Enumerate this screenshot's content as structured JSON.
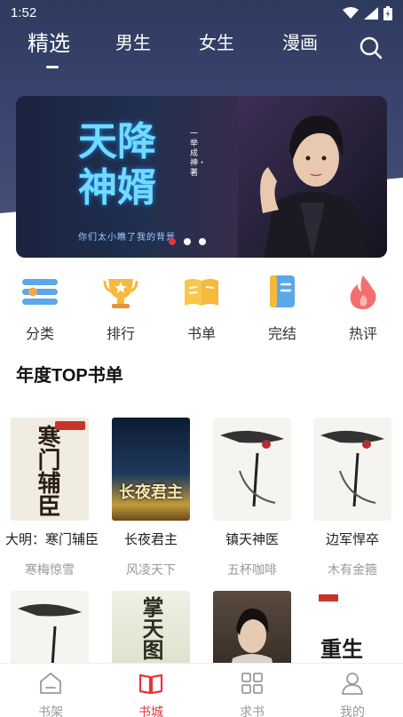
{
  "status": {
    "time": "1:52"
  },
  "tabs": [
    {
      "label": "精选",
      "active": true
    },
    {
      "label": "男生"
    },
    {
      "label": "女生"
    },
    {
      "label": "漫画"
    }
  ],
  "banner": {
    "title": "天降神婿",
    "author": "一举成神・著",
    "tagline": "你们太小瞧了我的背景",
    "slides": 3,
    "active_slide": 1
  },
  "quick_nav": [
    {
      "label": "分类",
      "icon": "category-icon"
    },
    {
      "label": "排行",
      "icon": "trophy-icon"
    },
    {
      "label": "书单",
      "icon": "book-list-icon"
    },
    {
      "label": "完结",
      "icon": "completed-icon"
    },
    {
      "label": "热评",
      "icon": "hot-comment-icon"
    }
  ],
  "section": {
    "title": "年度TOP书单"
  },
  "books": [
    {
      "name": "大明：寒门辅臣",
      "author": "寒梅惊雪",
      "cover_text": "寒门辅臣"
    },
    {
      "name": "长夜君主",
      "author": "风凌天下",
      "cover_text": "长夜君主"
    },
    {
      "name": "镇天神医",
      "author": "五杯咖啡"
    },
    {
      "name": "边军悍卒",
      "author": "木有金箍"
    }
  ],
  "books_row2": [
    {},
    {
      "cover_text": "掌天图"
    },
    {},
    {
      "cover_text": "重生"
    }
  ],
  "bottom_nav": [
    {
      "label": "书架",
      "icon": "bookshelf-icon"
    },
    {
      "label": "书城",
      "icon": "bookstore-icon",
      "active": true
    },
    {
      "label": "求书",
      "icon": "request-book-icon"
    },
    {
      "label": "我的",
      "icon": "profile-icon"
    }
  ],
  "colors": {
    "accent": "#e6353b",
    "header": "#2e3a5e"
  }
}
